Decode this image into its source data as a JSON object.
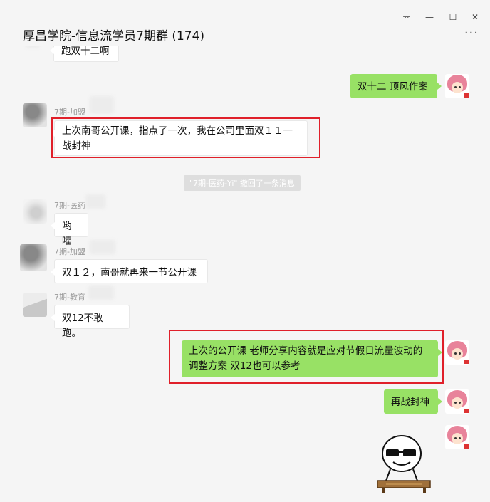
{
  "window": {
    "title": "厚昌学院-信息流学员7期群 (174)",
    "controls": {
      "pin": "ᅲ",
      "minimize": "—",
      "maximize": "☐",
      "close": "✕"
    },
    "more": "···"
  },
  "messages": [
    {
      "id": "m0",
      "direction": "in",
      "sender": "",
      "text": "跑双十二啊"
    },
    {
      "id": "m1",
      "direction": "out",
      "text": "双十二 顶风作案"
    },
    {
      "id": "m2",
      "direction": "in",
      "sender": "7期-加盟",
      "text": "上次南哥公开课，指点了一次，我在公司里面双１１一战封神",
      "highlighted": true
    },
    {
      "id": "sys1",
      "direction": "system",
      "text": "\"7期-医药-Yi\" 撤回了一条消息"
    },
    {
      "id": "m3",
      "direction": "in",
      "sender": "7期-医药",
      "text": "哟嚯"
    },
    {
      "id": "m4",
      "direction": "in",
      "sender": "7期-加盟",
      "text": "双１２，南哥就再来一节公开课"
    },
    {
      "id": "m5",
      "direction": "in",
      "sender": "7期-教育",
      "text": "双12不敢跑。"
    },
    {
      "id": "m6",
      "direction": "out",
      "text": "上次的公开课 老师分享内容就是应对节假日流量波动的调整方案  双12也可以参考",
      "highlighted": true
    },
    {
      "id": "m7",
      "direction": "out",
      "text": "再战封神"
    },
    {
      "id": "m8",
      "direction": "out",
      "type": "sticker",
      "sticker": "cool-meme-face-sticker"
    }
  ],
  "icons": {
    "more": "more-dots-icon",
    "avatar_self": "anime-girl-avatar",
    "sticker": "sunglasses-meme-sticker"
  },
  "colors": {
    "outgoing_bubble": "#98e165",
    "incoming_bubble": "#ffffff",
    "highlight": "#e0202a",
    "background": "#f5f5f5"
  }
}
